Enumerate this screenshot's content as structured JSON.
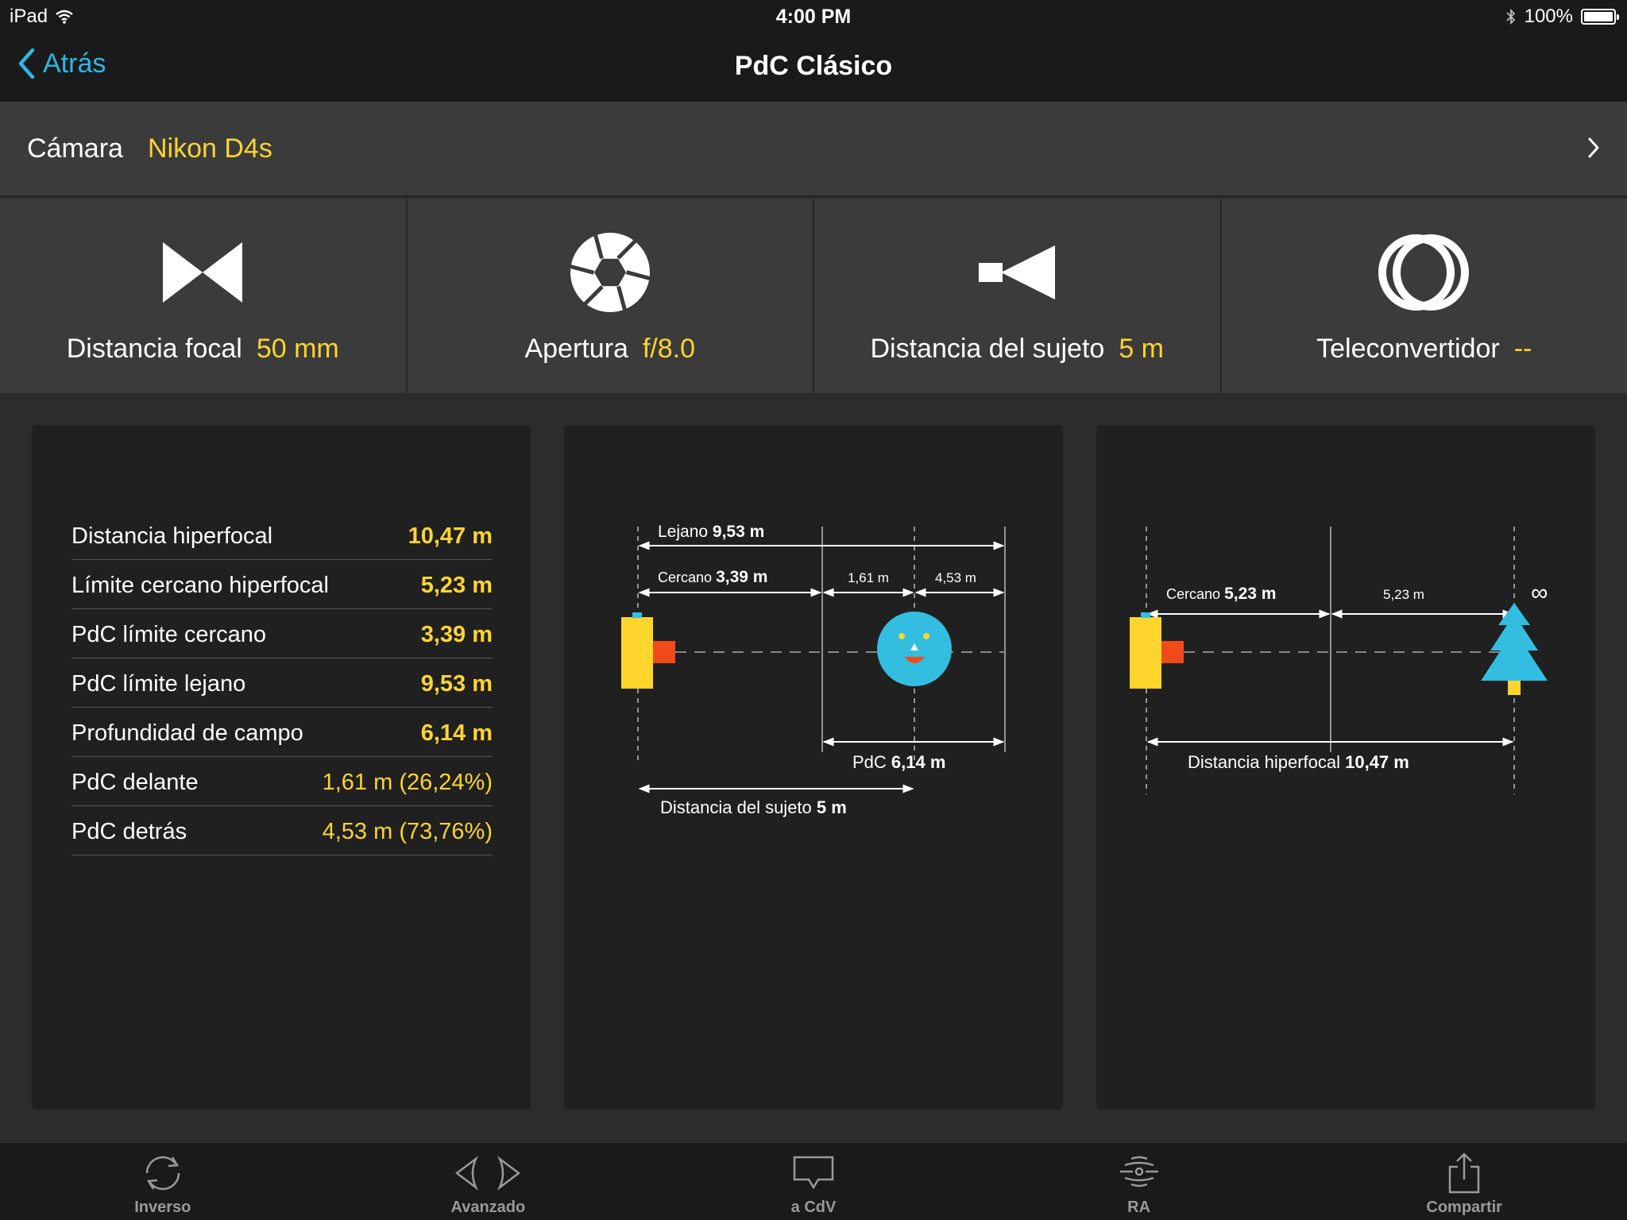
{
  "status_bar": {
    "device": "iPad",
    "time": "4:00 PM",
    "battery": "100%"
  },
  "nav": {
    "back_label": "Atrás",
    "title": "PdC Clásico"
  },
  "camera": {
    "label": "Cámara",
    "value": "Nikon D4s"
  },
  "params": [
    {
      "label": "Distancia focal",
      "value": "50 mm",
      "icon": "focal-length-icon"
    },
    {
      "label": "Apertura",
      "value": "f/8.0",
      "icon": "aperture-icon"
    },
    {
      "label": "Distancia del sujeto",
      "value": "5 m",
      "icon": "subject-distance-icon"
    },
    {
      "label": "Teleconvertidor",
      "value": "--",
      "icon": "teleconverter-icon"
    }
  ],
  "results": [
    {
      "label": "Distancia hiperfocal",
      "value": "10,47 m",
      "bold": true
    },
    {
      "label": "Límite cercano hiperfocal",
      "value": "5,23 m",
      "bold": true
    },
    {
      "label": "PdC límite cercano",
      "value": "3,39 m",
      "bold": true
    },
    {
      "label": "PdC límite lejano",
      "value": "9,53 m",
      "bold": true
    },
    {
      "label": "Profundidad de campo",
      "value": "6,14 m",
      "bold": true
    },
    {
      "label": "PdC delante",
      "value": "1,61 m (26,24%)",
      "bold": false
    },
    {
      "label": "PdC detrás",
      "value": "4,53 m (73,76%)",
      "bold": false
    }
  ],
  "dof_diagram": {
    "far_label": "Lejano",
    "far_value": "9,53 m",
    "near_label": "Cercano",
    "near_value": "3,39 m",
    "front_value": "1,61 m",
    "behind_value": "4,53 m",
    "dof_label": "PdC",
    "dof_value": "6,14 m",
    "subject_label": "Distancia del sujeto",
    "subject_value": "5 m"
  },
  "hyperfocal_diagram": {
    "near_label": "Cercano",
    "near_value": "5,23 m",
    "half_value": "5,23 m",
    "infinity": "∞",
    "hyper_label": "Distancia hiperfocal",
    "hyper_value": "10,47 m"
  },
  "colors": {
    "accent": "#fdd52d",
    "link": "#2cb8e6",
    "camera_body": "#fdd52d",
    "lens": "#f04a1a",
    "subject": "#33bde0"
  },
  "tabbar": [
    {
      "label": "Inverso",
      "icon": "inverse-icon"
    },
    {
      "label": "Avanzado",
      "icon": "advanced-icon"
    },
    {
      "label": "a CdV",
      "icon": "to-fov-icon"
    },
    {
      "label": "RA",
      "icon": "ar-icon"
    },
    {
      "label": "Compartir",
      "icon": "share-icon"
    }
  ]
}
